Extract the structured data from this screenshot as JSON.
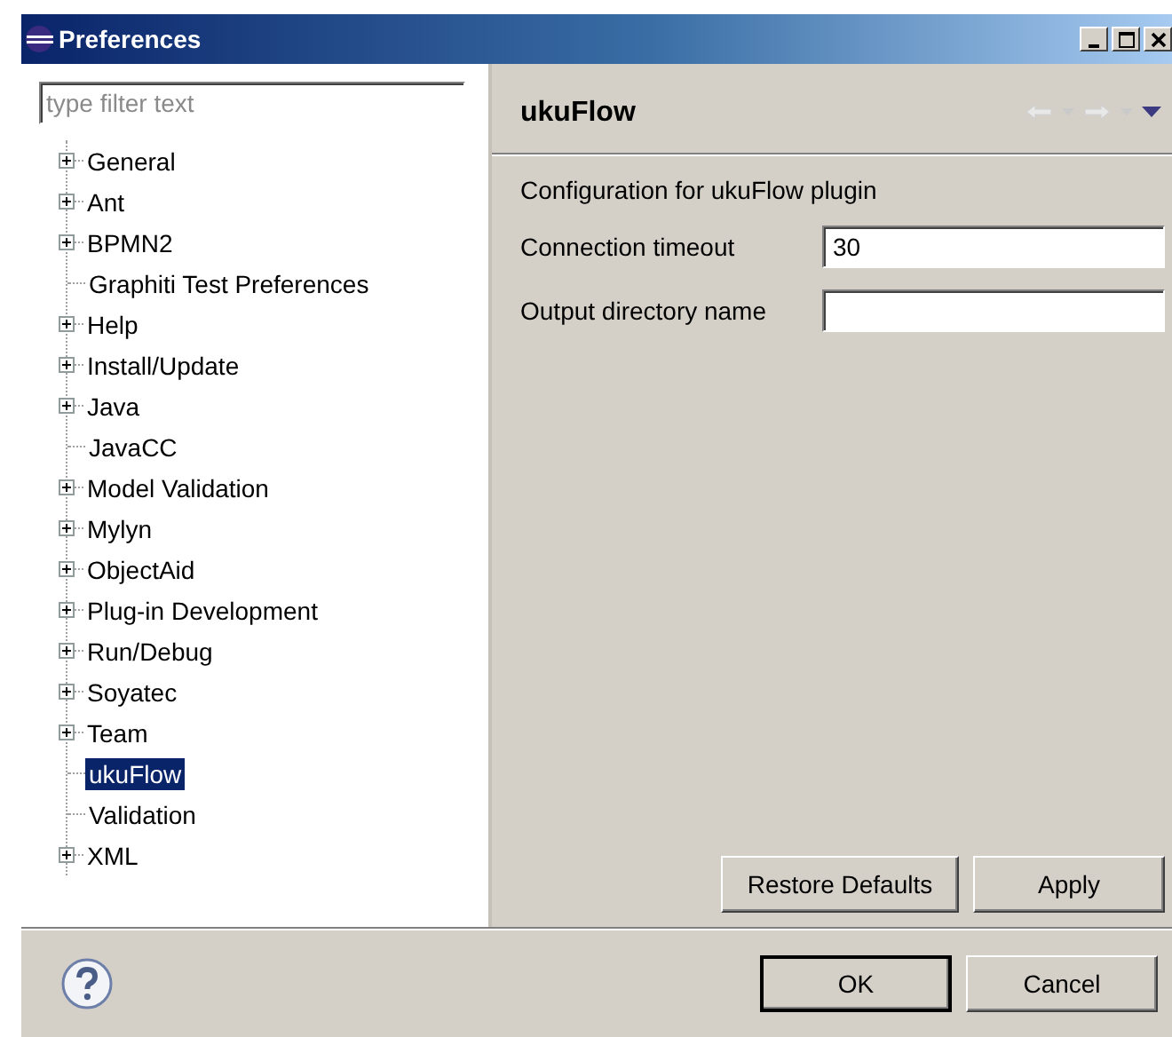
{
  "window": {
    "title": "Preferences"
  },
  "filter": {
    "placeholder": "type filter text"
  },
  "tree": [
    {
      "label": "General",
      "kind": "expandable",
      "selected": false
    },
    {
      "label": "Ant",
      "kind": "expandable",
      "selected": false
    },
    {
      "label": "BPMN2",
      "kind": "expandable",
      "selected": false
    },
    {
      "label": "Graphiti Test Preferences",
      "kind": "leaf",
      "selected": false
    },
    {
      "label": "Help",
      "kind": "expandable",
      "selected": false
    },
    {
      "label": "Install/Update",
      "kind": "expandable",
      "selected": false
    },
    {
      "label": "Java",
      "kind": "expandable",
      "selected": false
    },
    {
      "label": "JavaCC",
      "kind": "leaf",
      "selected": false
    },
    {
      "label": "Model Validation",
      "kind": "expandable",
      "selected": false
    },
    {
      "label": "Mylyn",
      "kind": "expandable",
      "selected": false
    },
    {
      "label": "ObjectAid",
      "kind": "expandable",
      "selected": false
    },
    {
      "label": "Plug-in Development",
      "kind": "expandable",
      "selected": false
    },
    {
      "label": "Run/Debug",
      "kind": "expandable",
      "selected": false
    },
    {
      "label": "Soyatec",
      "kind": "expandable",
      "selected": false
    },
    {
      "label": "Team",
      "kind": "expandable",
      "selected": false
    },
    {
      "label": "ukuFlow",
      "kind": "leaf",
      "selected": true
    },
    {
      "label": "Validation",
      "kind": "leaf",
      "selected": false
    },
    {
      "label": "XML",
      "kind": "expandable",
      "selected": false
    }
  ],
  "page": {
    "title": "ukuFlow",
    "description": "Configuration for ukuFlow plugin",
    "fields": [
      {
        "label": "Connection timeout",
        "value": "30"
      },
      {
        "label": "Output directory name"
      }
    ]
  },
  "page_buttons": [
    "Restore Defaults",
    "Apply"
  ],
  "dialog_buttons": [
    {
      "label": "OK",
      "default": true
    },
    {
      "label": "Cancel",
      "default": false
    }
  ]
}
